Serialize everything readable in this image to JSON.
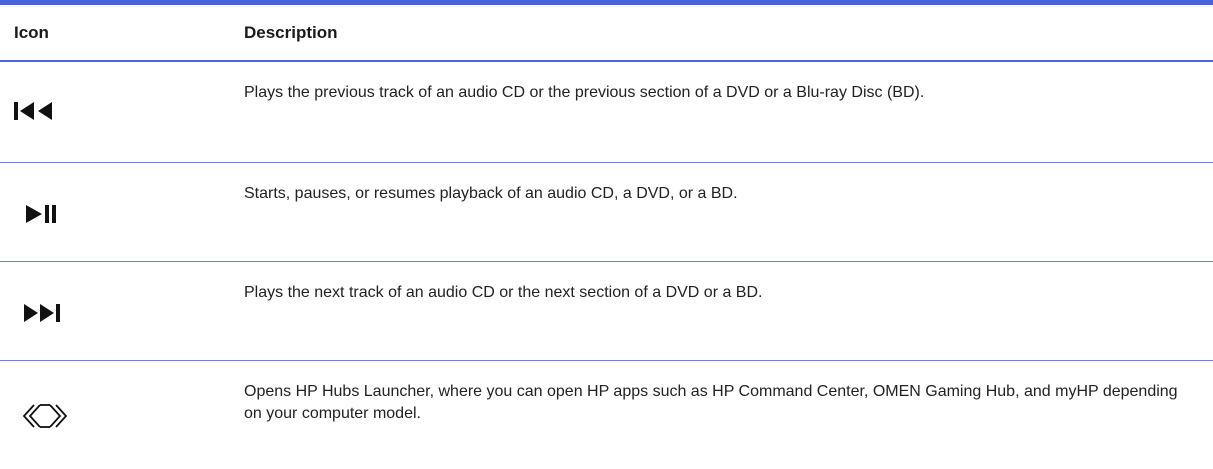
{
  "table": {
    "headers": {
      "icon": "Icon",
      "description": "Description"
    },
    "rows": [
      {
        "icon": "previous-track-icon",
        "description": "Plays the previous track of an audio CD or the previous section of a DVD or a Blu-ray Disc (BD)."
      },
      {
        "icon": "play-pause-icon",
        "description": "Starts, pauses, or resumes playback of an audio CD, a DVD, or a BD."
      },
      {
        "icon": "next-track-icon",
        "description": "Plays the next track of an audio CD or the next section of a DVD or a BD."
      },
      {
        "icon": "hp-hubs-launcher-icon",
        "description": "Opens HP Hubs Launcher, where you can open HP apps such as HP Command Center, OMEN Gaming Hub, and myHP depending on your computer model."
      }
    ],
    "colors": {
      "rule": "#4a63d6",
      "text": "#1a1a1a"
    }
  }
}
